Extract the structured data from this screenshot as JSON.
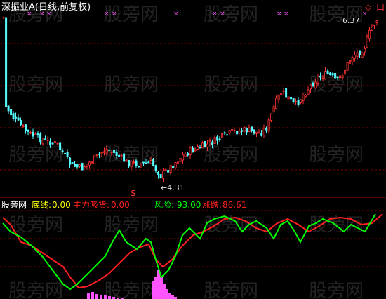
{
  "chart_title": "深振业A(日线,前复权)",
  "watermark": "股旁网",
  "top_right_icons": [
    "◇",
    "口"
  ],
  "main_chart": {
    "high_label": "6.37",
    "low_label": "4.31",
    "marker_symbol": "$",
    "signal_marks": "×××",
    "colors": {
      "up": "#ff3232",
      "down": "#54ffff",
      "grid": "#800000",
      "panel_border": "#a00000",
      "signal_mark": "#ff54ff"
    }
  },
  "indicator": {
    "brand": "股旁网",
    "items": [
      {
        "label": "底线:",
        "value": "0.00",
        "color": "#ffff00"
      },
      {
        "label": "主力吸货:",
        "value": "0.00",
        "color": "#ff2020"
      },
      {
        "label": "风险:",
        "value": "93.00",
        "color": "#00ff00"
      },
      {
        "label": "涨跌:",
        "value": "86.61",
        "color": "#ff2020"
      }
    ],
    "colors": {
      "risk_line": "#00ff00",
      "change_line": "#ff2020",
      "absorb_bars": "#ff54ff"
    }
  }
}
